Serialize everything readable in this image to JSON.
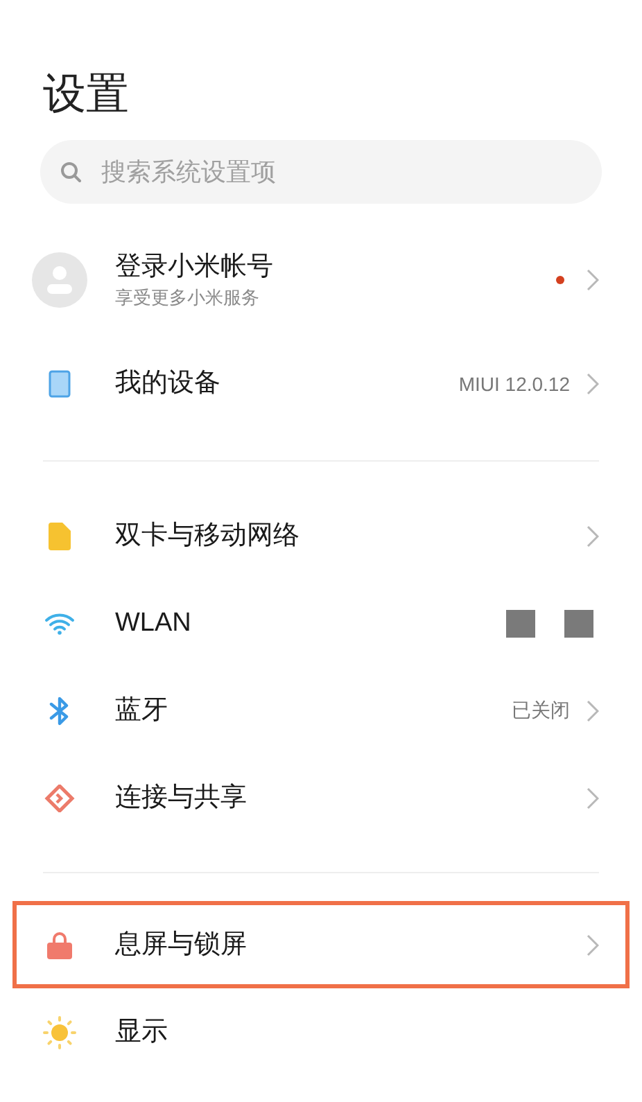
{
  "title": "设置",
  "search": {
    "placeholder": "搜索系统设置项"
  },
  "groups": [
    {
      "items": [
        {
          "kind": "account",
          "label": "登录小米帐号",
          "subtitle": "享受更多小米服务",
          "notification_dot": true,
          "chevron": true,
          "highlighted": false
        },
        {
          "kind": "device",
          "label": "我的设备",
          "value": "MIUI 12.0.12",
          "chevron": true,
          "highlighted": false
        }
      ]
    },
    {
      "items": [
        {
          "kind": "sim",
          "label": "双卡与移动网络",
          "chevron": true,
          "highlighted": false
        },
        {
          "kind": "wlan",
          "label": "WLAN",
          "redacted": true,
          "chevron": false,
          "highlighted": false
        },
        {
          "kind": "bluetooth",
          "label": "蓝牙",
          "value": "已关闭",
          "chevron": true,
          "highlighted": false
        },
        {
          "kind": "share",
          "label": "连接与共享",
          "chevron": true,
          "highlighted": false
        }
      ]
    },
    {
      "items": [
        {
          "kind": "lock",
          "label": "息屏与锁屏",
          "chevron": true,
          "highlighted": true
        },
        {
          "kind": "display",
          "label": "显示",
          "chevron": false,
          "highlighted": false
        }
      ]
    }
  ]
}
